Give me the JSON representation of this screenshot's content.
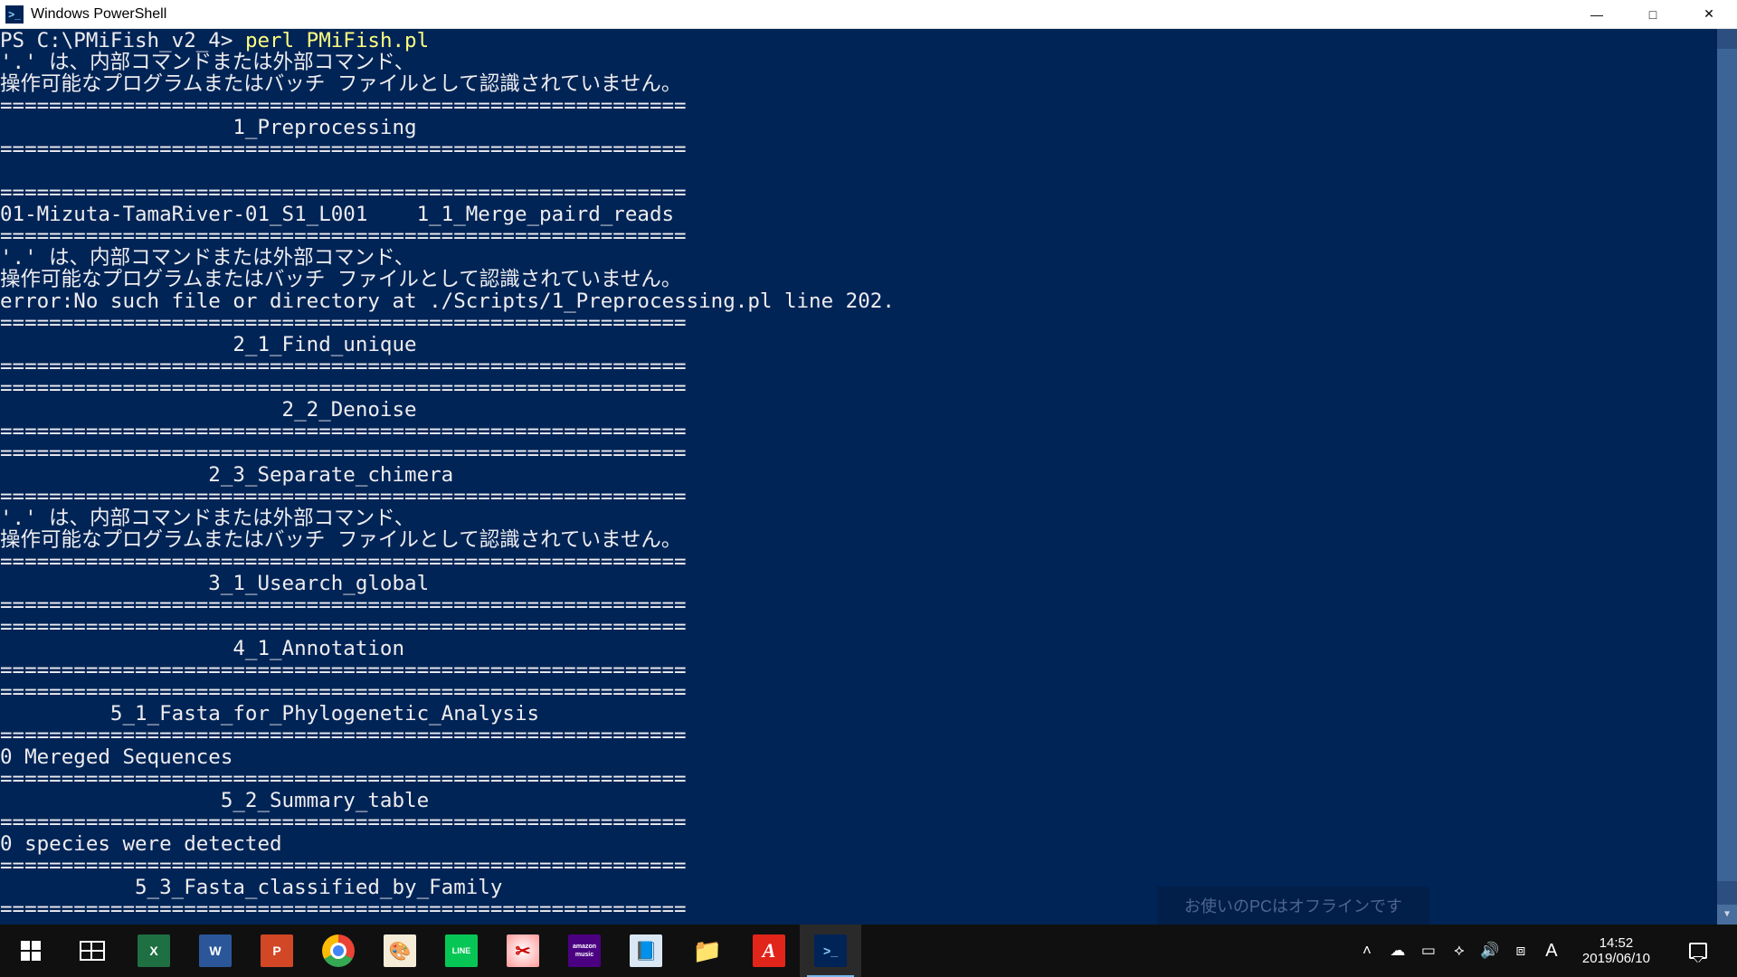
{
  "window": {
    "title": "Windows PowerShell",
    "icon_glyph": ">_"
  },
  "prompt": {
    "prefix": "PS C:\\PMiFish_v2_4> ",
    "command": "perl PMiFish.pl"
  },
  "sep": "========================================================",
  "err_jp_1": "'.' は、内部コマンドまたは外部コマンド、",
  "err_jp_2": "操作可能なプログラムまたはバッチ ファイルとして認識されていません。",
  "err_file": "error:No such file or directory at ./Scripts/1_Preprocessing.pl line 202.",
  "sections": {
    "s1": "                   1_Preprocessing",
    "s11": "01-Mizuta-TamaRiver-01_S1_L001    1_1_Merge_paird_reads",
    "s21": "                   2_1_Find_unique",
    "s22": "                       2_2_Denoise",
    "s23": "                 2_3_Separate_chimera",
    "s31": "                 3_1_Usearch_global",
    "s41": "                   4_1_Annotation",
    "s51": "         5_1_Fasta_for_Phylogenetic_Analysis",
    "s52": "                  5_2_Summary_table",
    "s53": "           5_3_Fasta_classified_by_Family"
  },
  "merged": "0 Mereged Sequences",
  "species": "0 species were detected",
  "taskbar": {
    "apps": [
      {
        "name": "start",
        "label": "",
        "bg": "transparent"
      },
      {
        "name": "taskview",
        "label": "",
        "bg": "transparent"
      },
      {
        "name": "excel",
        "label": "X",
        "bg": "#1e6f42"
      },
      {
        "name": "word",
        "label": "W",
        "bg": "#2b579a"
      },
      {
        "name": "powerpoint",
        "label": "P",
        "bg": "#d24726"
      },
      {
        "name": "chrome",
        "label": "",
        "bg": "chrome"
      },
      {
        "name": "paint",
        "label": "🎨",
        "bg": "#f0f0f0"
      },
      {
        "name": "line",
        "label": "LINE",
        "bg": "#06c755"
      },
      {
        "name": "snip",
        "label": "✂",
        "bg": "linear-gradient(135deg,#ff6,#f66)"
      },
      {
        "name": "amazon-music",
        "label": "amazon\nmusic",
        "bg": "#4b0082"
      },
      {
        "name": "notepad",
        "label": "📘",
        "bg": "#d9e7f5"
      },
      {
        "name": "explorer",
        "label": "📁",
        "bg": "#ffcf4b"
      },
      {
        "name": "acrobat",
        "label": "A",
        "bg": "#e1251b"
      },
      {
        "name": "powershell",
        "label": ">_",
        "bg": "#012456",
        "active": true
      }
    ],
    "clock": {
      "time": "14:52",
      "date": "2019/06/10"
    },
    "ime": "A"
  },
  "hidden_banner": "お使いのPCはオフラインです"
}
